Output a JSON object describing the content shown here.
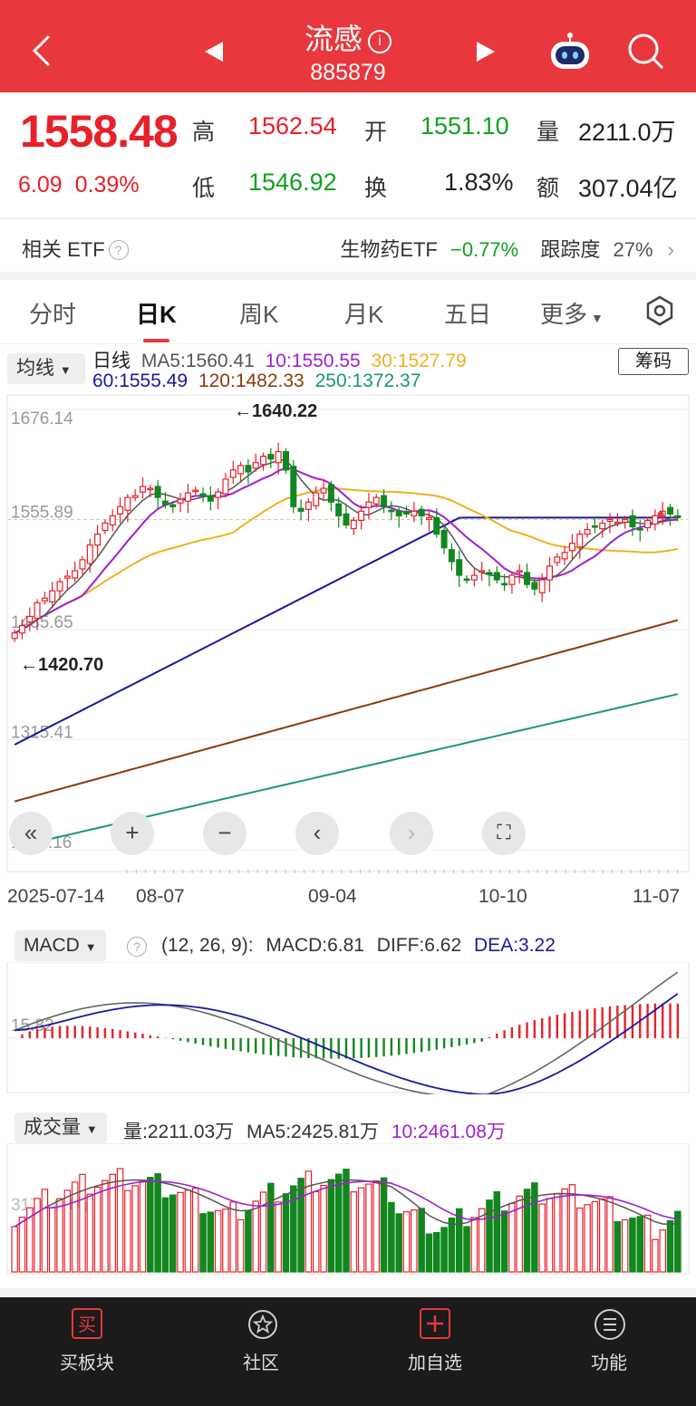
{
  "header": {
    "title": "流感",
    "code": "885879"
  },
  "quote": {
    "price": "1558.48",
    "change": "6.09",
    "change_pct": "0.39%",
    "high_label": "高",
    "high": "1562.54",
    "low_label": "低",
    "low": "1546.92",
    "open_label": "开",
    "open": "1551.10",
    "turnover_label": "换",
    "turnover": "1.83%",
    "volume_label": "量",
    "volume": "2211.0万",
    "amount_label": "额",
    "amount": "307.04亿"
  },
  "etf": {
    "label": "相关 ETF",
    "name": "生物药ETF",
    "change": "−0.77%",
    "track_label": "跟踪度",
    "track": "27%"
  },
  "tabs": [
    {
      "label": "分时"
    },
    {
      "label": "日K"
    },
    {
      "label": "周K"
    },
    {
      "label": "月K"
    },
    {
      "label": "五日"
    },
    {
      "label": "更多"
    }
  ],
  "kline": {
    "ma_button": "均线",
    "chip_button": "筹码",
    "legend_day": "日线",
    "ma5": "MA5:1560.41",
    "ma10": "10:1550.55",
    "ma30": "30:1527.79",
    "ma60": "60:1555.49",
    "ma120": "120:1482.33",
    "ma250": "250:1372.37",
    "y_labels": [
      "1676.14",
      "1555.89",
      "1435.65",
      "1315.41",
      "1195.16"
    ],
    "high_mark": "←1640.22",
    "low_mark": "←1420.70",
    "x_labels": [
      "2025-07-14",
      "08-07",
      "09-04",
      "10-10",
      "11-07"
    ],
    "colors": {
      "up": "#e8202a",
      "down": "#12871f",
      "ma5": "#555555",
      "ma10": "#a020d0",
      "ma30": "#f0b020",
      "ma60": "#1a1a9c",
      "ma120": "#8b3a10",
      "ma250": "#1a9a6a"
    }
  },
  "macd": {
    "button": "MACD",
    "params": "(12, 26, 9):",
    "macd": "MACD:6.81",
    "diff": "DIFF:6.62",
    "dea": "DEA:3.22",
    "ylabel": "15.82"
  },
  "volume": {
    "button": "成交量",
    "vol": "量:2211.03万",
    "ma5": "MA5:2425.81万",
    "ma10": "10:2461.08万",
    "ylabel": "3170.03万"
  },
  "bottom_nav": [
    {
      "label": "买板块",
      "icon": "买"
    },
    {
      "label": "社区"
    },
    {
      "label": "加自选"
    },
    {
      "label": "功能"
    }
  ],
  "chart_data": {
    "type": "candlestick",
    "x_range": [
      "2025-07-14",
      "2025-11-07"
    ],
    "ylim": [
      1195.16,
      1676.14
    ],
    "max_high": 1640.22,
    "min_low": 1420.7,
    "close": [
      1432,
      1440,
      1450,
      1465,
      1470,
      1478,
      1488,
      1494,
      1500,
      1512,
      1528,
      1540,
      1552,
      1560,
      1570,
      1580,
      1582,
      1592,
      1590,
      1580,
      1572,
      1570,
      1578,
      1585,
      1588,
      1582,
      1576,
      1586,
      1600,
      1610,
      1615,
      1608,
      1618,
      1625,
      1622,
      1630,
      1610,
      1570,
      1565,
      1575,
      1585,
      1590,
      1575,
      1560,
      1550,
      1555,
      1565,
      1575,
      1580,
      1570,
      1565,
      1560,
      1562,
      1565,
      1560,
      1558,
      1540,
      1525,
      1510,
      1495,
      1490,
      1495,
      1500,
      1496,
      1490,
      1485,
      1495,
      1500,
      1485,
      1480,
      1490,
      1505,
      1515,
      1520,
      1530,
      1540,
      1545,
      1548,
      1552,
      1556,
      1553,
      1556,
      1548,
      1545,
      1555,
      1560,
      1565,
      1562,
      1558
    ]
  }
}
